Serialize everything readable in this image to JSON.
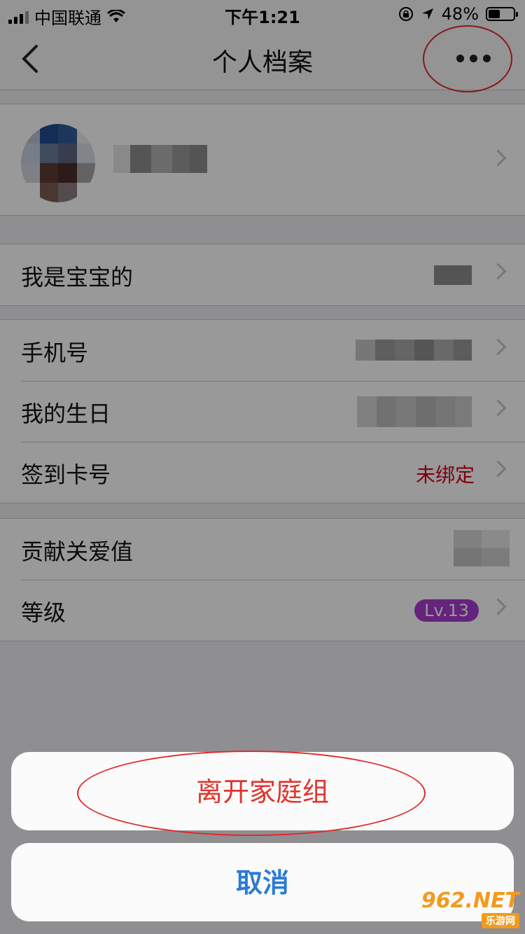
{
  "status_bar": {
    "carrier": "中国联通",
    "time": "下午1:21",
    "battery_percent": "48%",
    "battery_level": 0.48
  },
  "nav": {
    "title": "个人档案"
  },
  "rows": {
    "relation_label": "我是宝宝的",
    "phone_label": "手机号",
    "birthday_label": "我的生日",
    "card_label": "签到卡号",
    "card_value": "未绑定",
    "care_label": "贡献关爱值",
    "level_label": "等级",
    "level_value": "Lv.13"
  },
  "action_sheet": {
    "leave_label": "离开家庭组",
    "cancel_label": "取消"
  },
  "watermark": {
    "brand": "962.NET",
    "site": "乐游网"
  },
  "colors": {
    "annotation": "#e0292b",
    "destructive": "#e0342f",
    "cancel": "#2b7bd6",
    "level_badge": "#a93ccf",
    "unbound_text": "#d0021b"
  }
}
